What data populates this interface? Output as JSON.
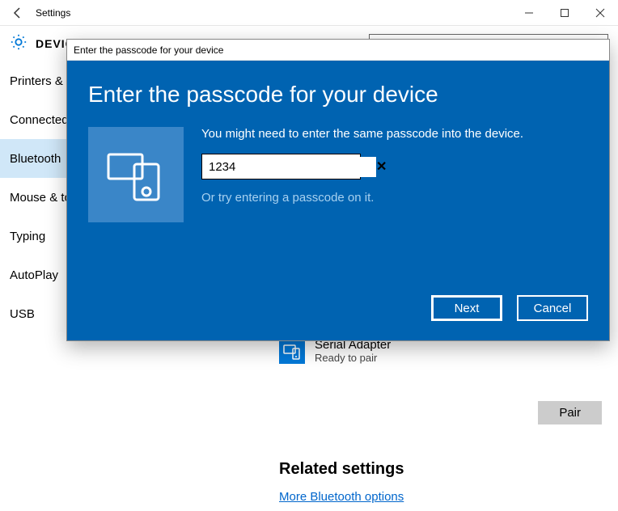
{
  "titlebar": {
    "title": "Settings"
  },
  "header": {
    "title": "DEVICES"
  },
  "sidebar": {
    "items": [
      {
        "label": "Printers & scanners"
      },
      {
        "label": "Connected devices"
      },
      {
        "label": "Bluetooth"
      },
      {
        "label": "Mouse & touchpad"
      },
      {
        "label": "Typing"
      },
      {
        "label": "AutoPlay"
      },
      {
        "label": "USB"
      }
    ],
    "selected": 2
  },
  "device": {
    "name": "Serial Adapter",
    "status": "Ready to pair"
  },
  "pair_label": "Pair",
  "related": {
    "heading": "Related settings",
    "link": "More Bluetooth options"
  },
  "modal": {
    "header": "Enter the passcode for your device",
    "title": "Enter the passcode for your device",
    "message": "You might need to enter the same passcode into the device.",
    "input_value": "1234",
    "alt_message": "Or try entering a passcode on it.",
    "next_label": "Next",
    "cancel_label": "Cancel"
  }
}
